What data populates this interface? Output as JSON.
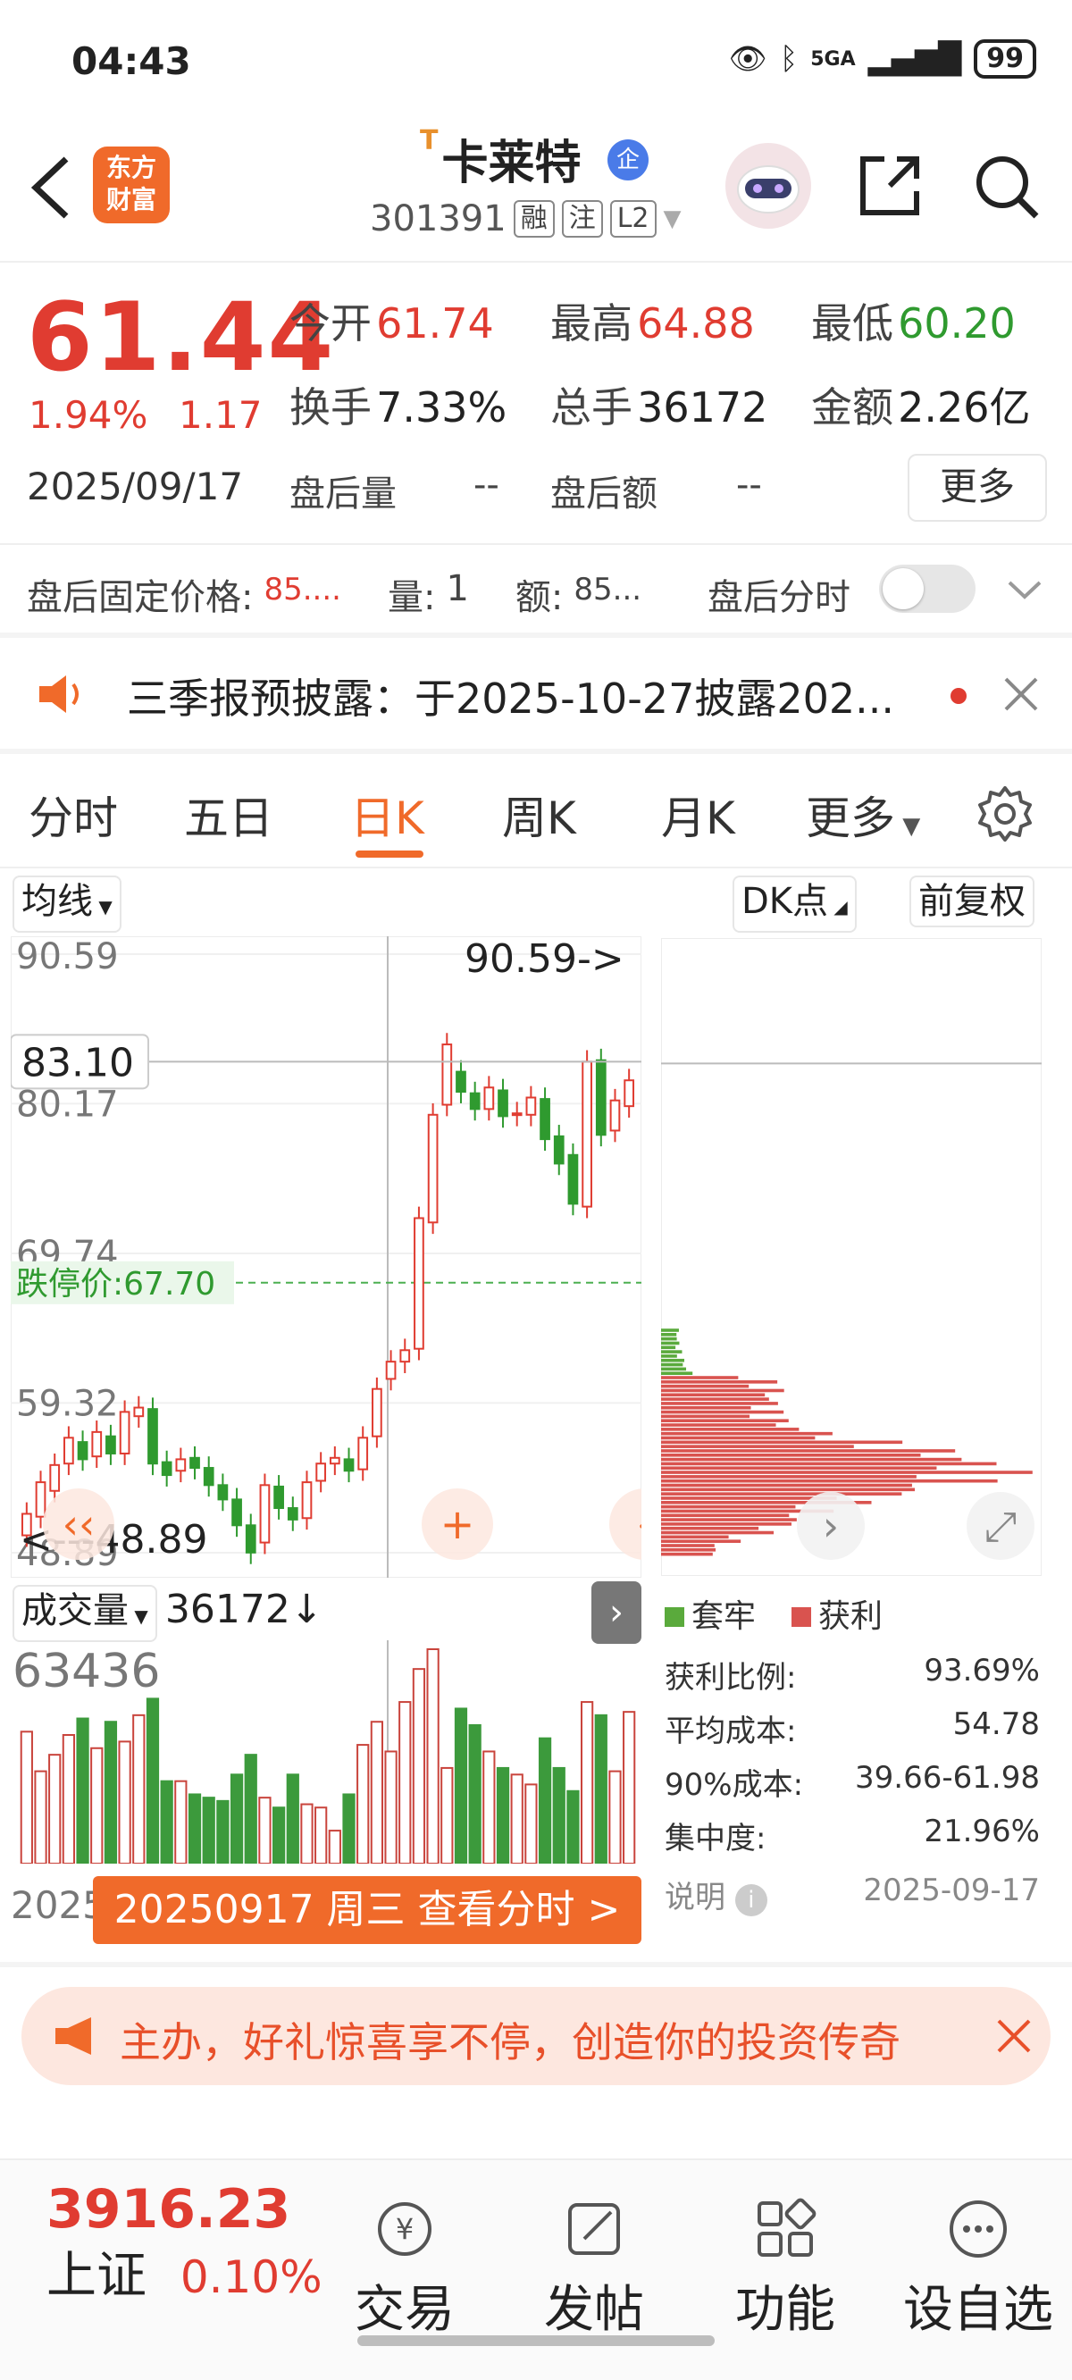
{
  "status": {
    "time": "04:43",
    "network": "5GA",
    "battery": "99"
  },
  "header": {
    "stock_name": "卡莱特",
    "name_mark": "T",
    "verified_badge": "企",
    "stock_code": "301391",
    "tags": [
      "融",
      "注",
      "L2"
    ],
    "logo_text_1": "东方",
    "logo_text_2": "财富"
  },
  "quote": {
    "price": "61.44",
    "change_pct": "1.94%",
    "change_amt": "1.17",
    "date": "2025/09/17",
    "open_label": "今开",
    "open": "61.74",
    "high_label": "最高",
    "high": "64.88",
    "low_label": "最低",
    "low": "60.20",
    "turnover_label": "换手",
    "turnover": "7.33%",
    "volume_label": "总手",
    "volume": "36172",
    "amount_label": "金额",
    "amount": "2.26亿",
    "ah_vol_label": "盘后量",
    "ah_vol": "--",
    "ah_amt_label": "盘后额",
    "ah_amt": "--",
    "more_label": "更多"
  },
  "after_hours": {
    "fixed_price_label": "盘后固定价格:",
    "fixed_price": "85....",
    "qty_label": "量:",
    "qty": "1",
    "amt_label": "额:",
    "amt": "85...",
    "timeshare_label": "盘后分时",
    "timeshare_on": false
  },
  "notice": {
    "text": "三季报预披露：于2025-10-27披露202..."
  },
  "tabs": [
    "分时",
    "五日",
    "日K",
    "周K",
    "月K",
    "更多"
  ],
  "active_tab": "日K",
  "chart_controls": {
    "ma": "均线",
    "dk": "DK点",
    "adjust": "前复权"
  },
  "chart_data": {
    "type": "candlestick",
    "title": "",
    "y_axis_labels": [
      "90.59",
      "80.17",
      "69.74",
      "59.32",
      "48.89"
    ],
    "crosshair_price": "83.10",
    "limit_down_label": "跌停价:67.70",
    "max_marker": "90.59->",
    "min_marker": "<---48.89",
    "ylim": [
      48.89,
      90.59
    ],
    "candles": [
      {
        "o": 50.1,
        "c": 51.6
      },
      {
        "o": 51.4,
        "c": 53.8
      },
      {
        "o": 53.2,
        "c": 55.0
      },
      {
        "o": 55.1,
        "c": 56.9
      },
      {
        "o": 56.6,
        "c": 55.4
      },
      {
        "o": 55.6,
        "c": 57.3
      },
      {
        "o": 57.0,
        "c": 55.8
      },
      {
        "o": 55.8,
        "c": 58.7
      },
      {
        "o": 58.4,
        "c": 59.0
      },
      {
        "o": 58.9,
        "c": 55.1
      },
      {
        "o": 55.2,
        "c": 54.3
      },
      {
        "o": 54.6,
        "c": 55.4
      },
      {
        "o": 55.5,
        "c": 54.8
      },
      {
        "o": 54.8,
        "c": 53.6
      },
      {
        "o": 53.6,
        "c": 52.6
      },
      {
        "o": 52.6,
        "c": 50.8
      },
      {
        "o": 50.8,
        "c": 48.9
      },
      {
        "o": 49.6,
        "c": 53.6
      },
      {
        "o": 53.5,
        "c": 52.0
      },
      {
        "o": 52.0,
        "c": 51.2
      },
      {
        "o": 51.3,
        "c": 53.8
      },
      {
        "o": 53.9,
        "c": 55.1
      },
      {
        "o": 55.1,
        "c": 55.5
      },
      {
        "o": 55.4,
        "c": 54.6
      },
      {
        "o": 54.7,
        "c": 56.9
      },
      {
        "o": 57.0,
        "c": 60.3
      },
      {
        "o": 61.0,
        "c": 62.2
      },
      {
        "o": 62.2,
        "c": 63.0
      },
      {
        "o": 63.1,
        "c": 72.2
      },
      {
        "o": 71.9,
        "c": 79.4
      },
      {
        "o": 80.1,
        "c": 84.3
      },
      {
        "o": 82.4,
        "c": 81.0
      },
      {
        "o": 80.9,
        "c": 79.8
      },
      {
        "o": 79.8,
        "c": 81.3
      },
      {
        "o": 81.1,
        "c": 79.3
      },
      {
        "o": 79.4,
        "c": 79.5
      },
      {
        "o": 79.4,
        "c": 80.6
      },
      {
        "o": 80.5,
        "c": 77.7
      },
      {
        "o": 77.9,
        "c": 76.0
      },
      {
        "o": 76.6,
        "c": 73.2
      },
      {
        "o": 73.0,
        "c": 83.1
      },
      {
        "o": 83.2,
        "c": 78.0
      },
      {
        "o": 78.3,
        "c": 80.4
      },
      {
        "o": 80.0,
        "c": 81.8
      }
    ],
    "volume": {
      "label": "成交量",
      "current": "36172↓",
      "axis_max": "63436",
      "bars": [
        40,
        28,
        33,
        39,
        44,
        35,
        43,
        37,
        45,
        50,
        25,
        25,
        21,
        20,
        19,
        27,
        33,
        20,
        17,
        27,
        18,
        17,
        10,
        21,
        36,
        43,
        34,
        49,
        59,
        65,
        29,
        47,
        42,
        34,
        29,
        27,
        24,
        38,
        29,
        22,
        49,
        45,
        28,
        46
      ]
    },
    "date_prefix": "2025"
  },
  "date_tooltip": "20250917 周三 查看分时 >",
  "chip": {
    "legend_loss": "套牢",
    "legend_profit": "获利",
    "profit_ratio_label": "获利比例:",
    "profit_ratio": "93.69%",
    "avg_cost_label": "平均成本:",
    "avg_cost": "54.78",
    "cost90_label": "90%成本:",
    "cost90": "39.66-61.98",
    "concentration_label": "集中度:",
    "concentration": "21.96%",
    "note_label": "说明",
    "date": "2025-09-17"
  },
  "promo": {
    "text": "主办，好礼惊喜享不停，创造你的投资传奇"
  },
  "bottom_nav": {
    "index_value": "3916.23",
    "index_name": "上证",
    "index_change": "0.10%",
    "trade": "交易",
    "post": "发帖",
    "functions": "功能",
    "watchlist": "设自选"
  },
  "colors": {
    "up": "#e03c31",
    "down": "#2f9a2f",
    "accent": "#f06a2a"
  }
}
